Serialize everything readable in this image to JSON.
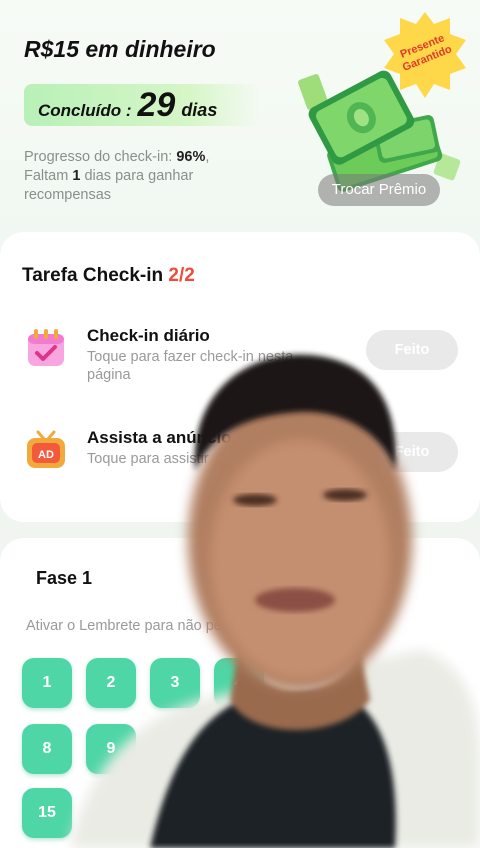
{
  "reward": {
    "title": "R$15 em dinheiro",
    "done_label": "Concluído :",
    "done_days": "29",
    "done_unit": "dias",
    "progress_label": "Progresso do check-in: ",
    "progress_pct": "96%",
    "progress_tail": ",",
    "remaining_prefix": "Faltam ",
    "remaining_days": "1",
    "remaining_suffix": " dias para ganhar recompensas",
    "badge_line1": "Presente",
    "badge_line2": "Garantido",
    "swap_label": "Trocar Prêmio"
  },
  "tasks": {
    "title": "Tarefa Check-in ",
    "ratio": "2/2",
    "items": [
      {
        "name": "Check-in diário",
        "desc": "Toque para fazer check-in nesta página",
        "button": "Feito",
        "icon": "calendar-icon"
      },
      {
        "name": "Assista a anúncio",
        "desc": "Toque para assistir",
        "button": "Feito",
        "icon": "ad-tv-icon"
      }
    ]
  },
  "phase": {
    "title": "Fase 1",
    "reminder": "Ativar o Lembrete para não perder",
    "days": [
      "1",
      "2",
      "3",
      "4",
      "8",
      "9",
      "15"
    ]
  },
  "colors": {
    "accent_green": "#4fd6a6",
    "ratio_red": "#f04a3a",
    "badge_yellow": "#ffd84a"
  }
}
